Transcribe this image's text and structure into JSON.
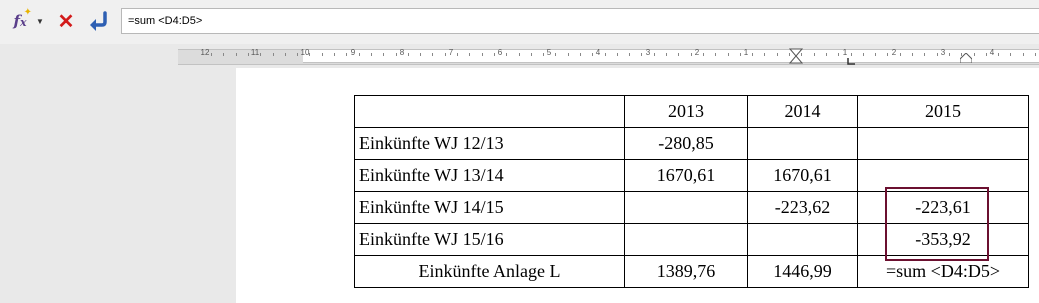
{
  "formula_bar": {
    "formula": "=sum <D4:D5>"
  },
  "ruler": {
    "labels": [
      "12",
      "11",
      "10",
      "9",
      "8",
      "7",
      "6",
      "5",
      "4",
      "3",
      "2",
      "1",
      "1",
      "2",
      "3",
      "4"
    ]
  },
  "table": {
    "rows": [
      [
        "",
        "2013",
        "2014",
        "2015"
      ],
      [
        "Einkünfte  WJ 12/13",
        "-280,85",
        "",
        ""
      ],
      [
        "Einkünfte WJ 13/14",
        "1670,61",
        "1670,61",
        ""
      ],
      [
        "Einkünfte WJ 14/15",
        "",
        "-223,62",
        "-223,61"
      ],
      [
        "Einkünfte WJ 15/16",
        "",
        "",
        "-353,92"
      ],
      [
        "Einkünfte Anlage L",
        "1389,76",
        "1446,99",
        "=sum <D4:D5>"
      ]
    ]
  },
  "colors": {
    "selection_border": "#6b1030",
    "cancel": "#d21a1a",
    "accept": "#2d5fb3"
  }
}
